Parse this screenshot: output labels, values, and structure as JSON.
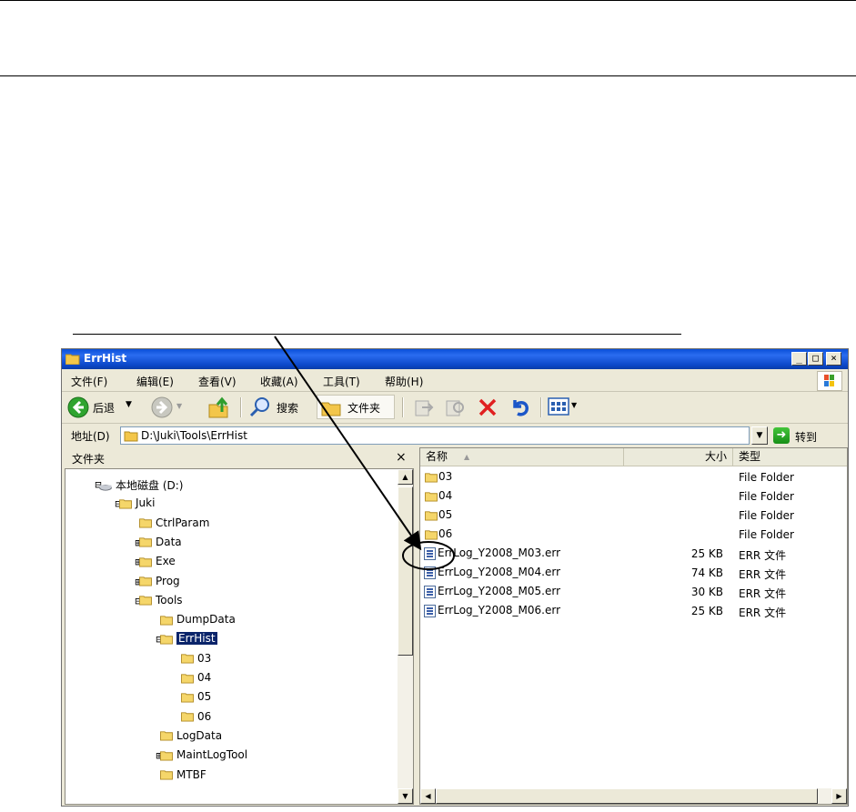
{
  "window": {
    "title": "ErrHist",
    "caption_min": "_",
    "caption_max": "□",
    "caption_close": "×"
  },
  "menu": [
    "文件(F)",
    "编辑(E)",
    "查看(V)",
    "收藏(A)",
    "工具(T)",
    "帮助(H)"
  ],
  "toolbar": {
    "back_label": "后退",
    "search_label": "搜索",
    "folders_label": "文件夹"
  },
  "address": {
    "label": "地址(D)",
    "value": "D:\\Juki\\Tools\\ErrHist",
    "go_label": "转到"
  },
  "folder_pane": {
    "title": "文件夹",
    "close": "×",
    "tree": [
      {
        "label": "本地磁盘 (D:)",
        "expander": "⊟",
        "icon": "drive-icon"
      },
      {
        "label": "Juki",
        "expander": "⊟",
        "icon": "folder-icon"
      },
      {
        "label": "CtrlParam",
        "expander": "",
        "icon": "folder-icon"
      },
      {
        "label": "Data",
        "expander": "⊞",
        "icon": "folder-icon"
      },
      {
        "label": "Exe",
        "expander": "⊞",
        "icon": "folder-icon"
      },
      {
        "label": "Prog",
        "expander": "⊞",
        "icon": "folder-icon"
      },
      {
        "label": "Tools",
        "expander": "⊟",
        "icon": "folder-icon"
      },
      {
        "label": "DumpData",
        "expander": "",
        "icon": "folder-icon"
      },
      {
        "label": "ErrHist",
        "expander": "⊟",
        "icon": "folder-open-icon",
        "selected": true
      },
      {
        "label": "03",
        "expander": "",
        "icon": "folder-icon"
      },
      {
        "label": "04",
        "expander": "",
        "icon": "folder-icon"
      },
      {
        "label": "05",
        "expander": "",
        "icon": "folder-icon"
      },
      {
        "label": "06",
        "expander": "",
        "icon": "folder-icon"
      },
      {
        "label": "LogData",
        "expander": "",
        "icon": "folder-icon"
      },
      {
        "label": "MaintLogTool",
        "expander": "⊞",
        "icon": "folder-icon"
      },
      {
        "label": "MTBF",
        "expander": "",
        "icon": "folder-icon"
      }
    ]
  },
  "file_list": {
    "columns": [
      "名称",
      "大小",
      "类型"
    ],
    "sort_indicator": "▲",
    "rows": [
      {
        "name": "03",
        "size": "",
        "type": "File Folder",
        "icon": "folder-icon"
      },
      {
        "name": "04",
        "size": "",
        "type": "File Folder",
        "icon": "folder-icon"
      },
      {
        "name": "05",
        "size": "",
        "type": "File Folder",
        "icon": "folder-icon"
      },
      {
        "name": "06",
        "size": "",
        "type": "File Folder",
        "icon": "folder-icon"
      },
      {
        "name": "ErrLog_Y2008_M03.err",
        "size": "25 KB",
        "type": "ERR 文件",
        "icon": "file-icon"
      },
      {
        "name": "ErrLog_Y2008_M04.err",
        "size": "74 KB",
        "type": "ERR 文件",
        "icon": "file-icon"
      },
      {
        "name": "ErrLog_Y2008_M05.err",
        "size": "30 KB",
        "type": "ERR 文件",
        "icon": "file-icon"
      },
      {
        "name": "ErrLog_Y2008_M06.err",
        "size": "25 KB",
        "type": "ERR 文件",
        "icon": "file-icon"
      }
    ]
  },
  "colors": {
    "titlebar": "#0a4fd8",
    "selection": "#0a246a",
    "folder": "#f5d66a",
    "window_bg": "#ece9d8"
  }
}
